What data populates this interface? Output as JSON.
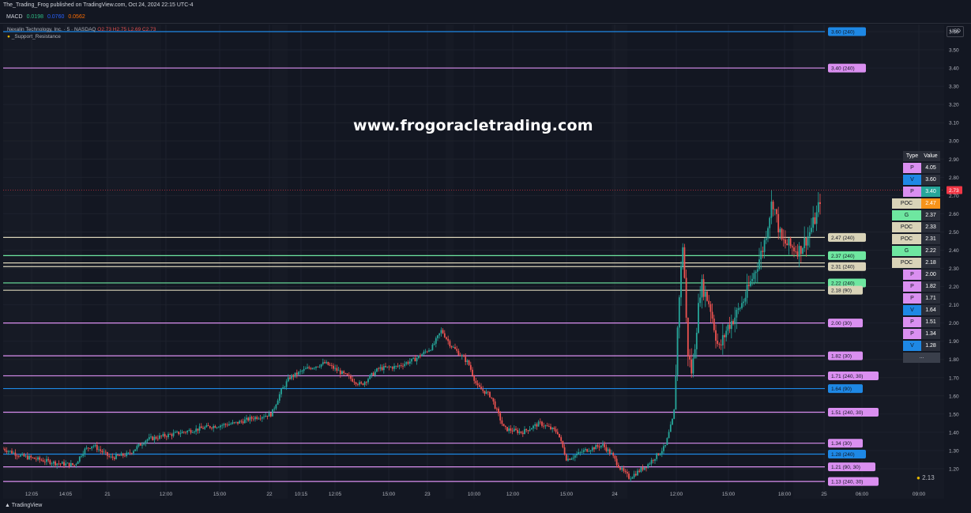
{
  "header": {
    "publisher_line": "The_Trading_Frog published on TradingView.com, Oct 24, 2024 22:15 UTC-4",
    "macd_label": "MACD",
    "macd_values": [
      "0.0198",
      "0.0760",
      "0.0562"
    ],
    "macd_colors": [
      "#2fbd85",
      "#2962ff",
      "#ff6d00"
    ]
  },
  "legend": {
    "symbol": "Nexalin Technology, Inc. · 5 · NASDAQ",
    "ohlc": "O2.73 H2.75 L2.69 C2.73",
    "indicator": "_Support_Resistance"
  },
  "currency": "USD",
  "watermark": "www.frogoracletrading.com",
  "footer": {
    "brand": "TradingView",
    "frog_value": "2.13"
  },
  "colors": {
    "background": "#131722",
    "grid": "#1e222d",
    "up": "#26a69a",
    "down": "#ef5350",
    "pivot": "#da8ff0",
    "volume": "#1e88e5",
    "poc": "#d9d3b8",
    "green_level": "#6ee7a0",
    "last_price": "#f23645",
    "poc_value": "#f7931a"
  },
  "levels_table": {
    "headers": [
      "Type",
      "Value"
    ],
    "rows": [
      {
        "type": "P",
        "value": "4.05",
        "color": "#da8ff0",
        "value_bg": "#2a2e39"
      },
      {
        "type": "V",
        "value": "3.60",
        "color": "#1e88e5",
        "value_bg": "#2a2e39"
      },
      {
        "type": "P",
        "value": "3.40",
        "color": "#da8ff0",
        "value_bg": "#26a69a"
      },
      {
        "type": "POC",
        "value": "2.47",
        "color": "#d9d3b8",
        "value_bg": "#f7931a"
      },
      {
        "type": "G",
        "value": "2.37",
        "color": "#6ee7a0",
        "value_bg": "#2a2e39"
      },
      {
        "type": "POC",
        "value": "2.33",
        "color": "#d9d3b8",
        "value_bg": "#2a2e39"
      },
      {
        "type": "POC",
        "value": "2.31",
        "color": "#d9d3b8",
        "value_bg": "#2a2e39"
      },
      {
        "type": "G",
        "value": "2.22",
        "color": "#6ee7a0",
        "value_bg": "#2a2e39"
      },
      {
        "type": "POC",
        "value": "2.18",
        "color": "#d9d3b8",
        "value_bg": "#2a2e39"
      },
      {
        "type": "P",
        "value": "2.00",
        "color": "#da8ff0",
        "value_bg": "#2a2e39"
      },
      {
        "type": "P",
        "value": "1.82",
        "color": "#da8ff0",
        "value_bg": "#2a2e39"
      },
      {
        "type": "P",
        "value": "1.71",
        "color": "#da8ff0",
        "value_bg": "#2a2e39"
      },
      {
        "type": "V",
        "value": "1.64",
        "color": "#1e88e5",
        "value_bg": "#2a2e39"
      },
      {
        "type": "P",
        "value": "1.51",
        "color": "#da8ff0",
        "value_bg": "#2a2e39"
      },
      {
        "type": "P",
        "value": "1.34",
        "color": "#da8ff0",
        "value_bg": "#2a2e39"
      },
      {
        "type": "V",
        "value": "1.28",
        "color": "#1e88e5",
        "value_bg": "#2a2e39"
      }
    ],
    "more": "..."
  },
  "chart_data": {
    "type": "candlestick",
    "ylim": [
      1.15,
      3.62
    ],
    "y_ticks": [
      "3.60",
      "3.50",
      "3.40",
      "3.30",
      "3.20",
      "3.10",
      "3.00",
      "2.90",
      "2.80",
      "2.70",
      "2.60",
      "2.50",
      "2.40",
      "2.30",
      "2.20",
      "2.10",
      "2.00",
      "1.90",
      "1.80",
      "1.70",
      "1.60",
      "1.50",
      "1.40",
      "1.30",
      "1.20"
    ],
    "x_ticks": [
      "12:05",
      "14:05",
      "21",
      "12:00",
      "15:00",
      "22",
      "10:15",
      "12:05",
      "15:00",
      "23",
      "10:00",
      "12:00",
      "15:00",
      "24",
      "12:00",
      "15:00",
      "18:00",
      "25",
      "06:00",
      "09:00"
    ],
    "last_price": "2.73",
    "levels": [
      {
        "price": 3.6,
        "label": "3.60 (240)",
        "kind": "V"
      },
      {
        "price": 3.4,
        "label": "3.40 (240)",
        "kind": "P"
      },
      {
        "price": 2.47,
        "label": "2.47 (240)",
        "kind": "POC"
      },
      {
        "price": 2.37,
        "label": "2.37 (240)",
        "kind": "G"
      },
      {
        "price": 2.33,
        "label": "",
        "kind": "POC"
      },
      {
        "price": 2.31,
        "label": "2.31 (240)",
        "kind": "POC"
      },
      {
        "price": 2.22,
        "label": "2.22 (240)",
        "kind": "G"
      },
      {
        "price": 2.18,
        "label": "2.18 (90)",
        "kind": "POC"
      },
      {
        "price": 2.0,
        "label": "2.00 (30)",
        "kind": "P"
      },
      {
        "price": 1.82,
        "label": "1.82 (30)",
        "kind": "P"
      },
      {
        "price": 1.71,
        "label": "1.71 (240, 30)",
        "kind": "P"
      },
      {
        "price": 1.64,
        "label": "1.64 (90)",
        "kind": "V"
      },
      {
        "price": 1.51,
        "label": "1.51 (240, 30)",
        "kind": "P"
      },
      {
        "price": 1.34,
        "label": "1.34 (30)",
        "kind": "P"
      },
      {
        "price": 1.28,
        "label": "1.28 (240)",
        "kind": "V"
      },
      {
        "price": 1.21,
        "label": "1.21 (90, 30)",
        "kind": "P"
      },
      {
        "price": 1.13,
        "label": "1.13 (240, 30)",
        "kind": "P"
      }
    ],
    "price_path": [
      [
        0.0,
        1.31
      ],
      [
        0.02,
        1.27
      ],
      [
        0.04,
        1.25
      ],
      [
        0.06,
        1.23
      ],
      [
        0.08,
        1.22
      ],
      [
        0.09,
        1.3
      ],
      [
        0.1,
        1.33
      ],
      [
        0.12,
        1.26
      ],
      [
        0.14,
        1.28
      ],
      [
        0.16,
        1.36
      ],
      [
        0.18,
        1.38
      ],
      [
        0.2,
        1.4
      ],
      [
        0.23,
        1.43
      ],
      [
        0.26,
        1.45
      ],
      [
        0.28,
        1.48
      ],
      [
        0.3,
        1.5
      ],
      [
        0.31,
        1.62
      ],
      [
        0.32,
        1.7
      ],
      [
        0.34,
        1.75
      ],
      [
        0.36,
        1.78
      ],
      [
        0.38,
        1.72
      ],
      [
        0.4,
        1.66
      ],
      [
        0.42,
        1.75
      ],
      [
        0.44,
        1.76
      ],
      [
        0.46,
        1.8
      ],
      [
        0.48,
        1.87
      ],
      [
        0.49,
        1.96
      ],
      [
        0.5,
        1.88
      ],
      [
        0.52,
        1.78
      ],
      [
        0.53,
        1.65
      ],
      [
        0.545,
        1.6
      ],
      [
        0.56,
        1.42
      ],
      [
        0.58,
        1.4
      ],
      [
        0.6,
        1.45
      ],
      [
        0.62,
        1.4
      ],
      [
        0.63,
        1.25
      ],
      [
        0.65,
        1.3
      ],
      [
        0.67,
        1.33
      ],
      [
        0.68,
        1.28
      ],
      [
        0.69,
        1.2
      ],
      [
        0.7,
        1.15
      ],
      [
        0.72,
        1.22
      ],
      [
        0.74,
        1.32
      ],
      [
        0.75,
        1.5
      ],
      [
        0.755,
        2.1
      ],
      [
        0.76,
        2.45
      ],
      [
        0.765,
        1.85
      ],
      [
        0.77,
        1.72
      ],
      [
        0.78,
        2.22
      ],
      [
        0.79,
        2.1
      ],
      [
        0.8,
        1.85
      ],
      [
        0.81,
        1.98
      ],
      [
        0.82,
        2.05
      ],
      [
        0.83,
        2.15
      ],
      [
        0.84,
        2.28
      ],
      [
        0.85,
        2.42
      ],
      [
        0.86,
        2.68
      ],
      [
        0.87,
        2.45
      ],
      [
        0.88,
        2.42
      ],
      [
        0.89,
        2.4
      ],
      [
        0.9,
        2.48
      ],
      [
        0.91,
        2.6
      ],
      [
        0.915,
        2.73
      ]
    ]
  }
}
